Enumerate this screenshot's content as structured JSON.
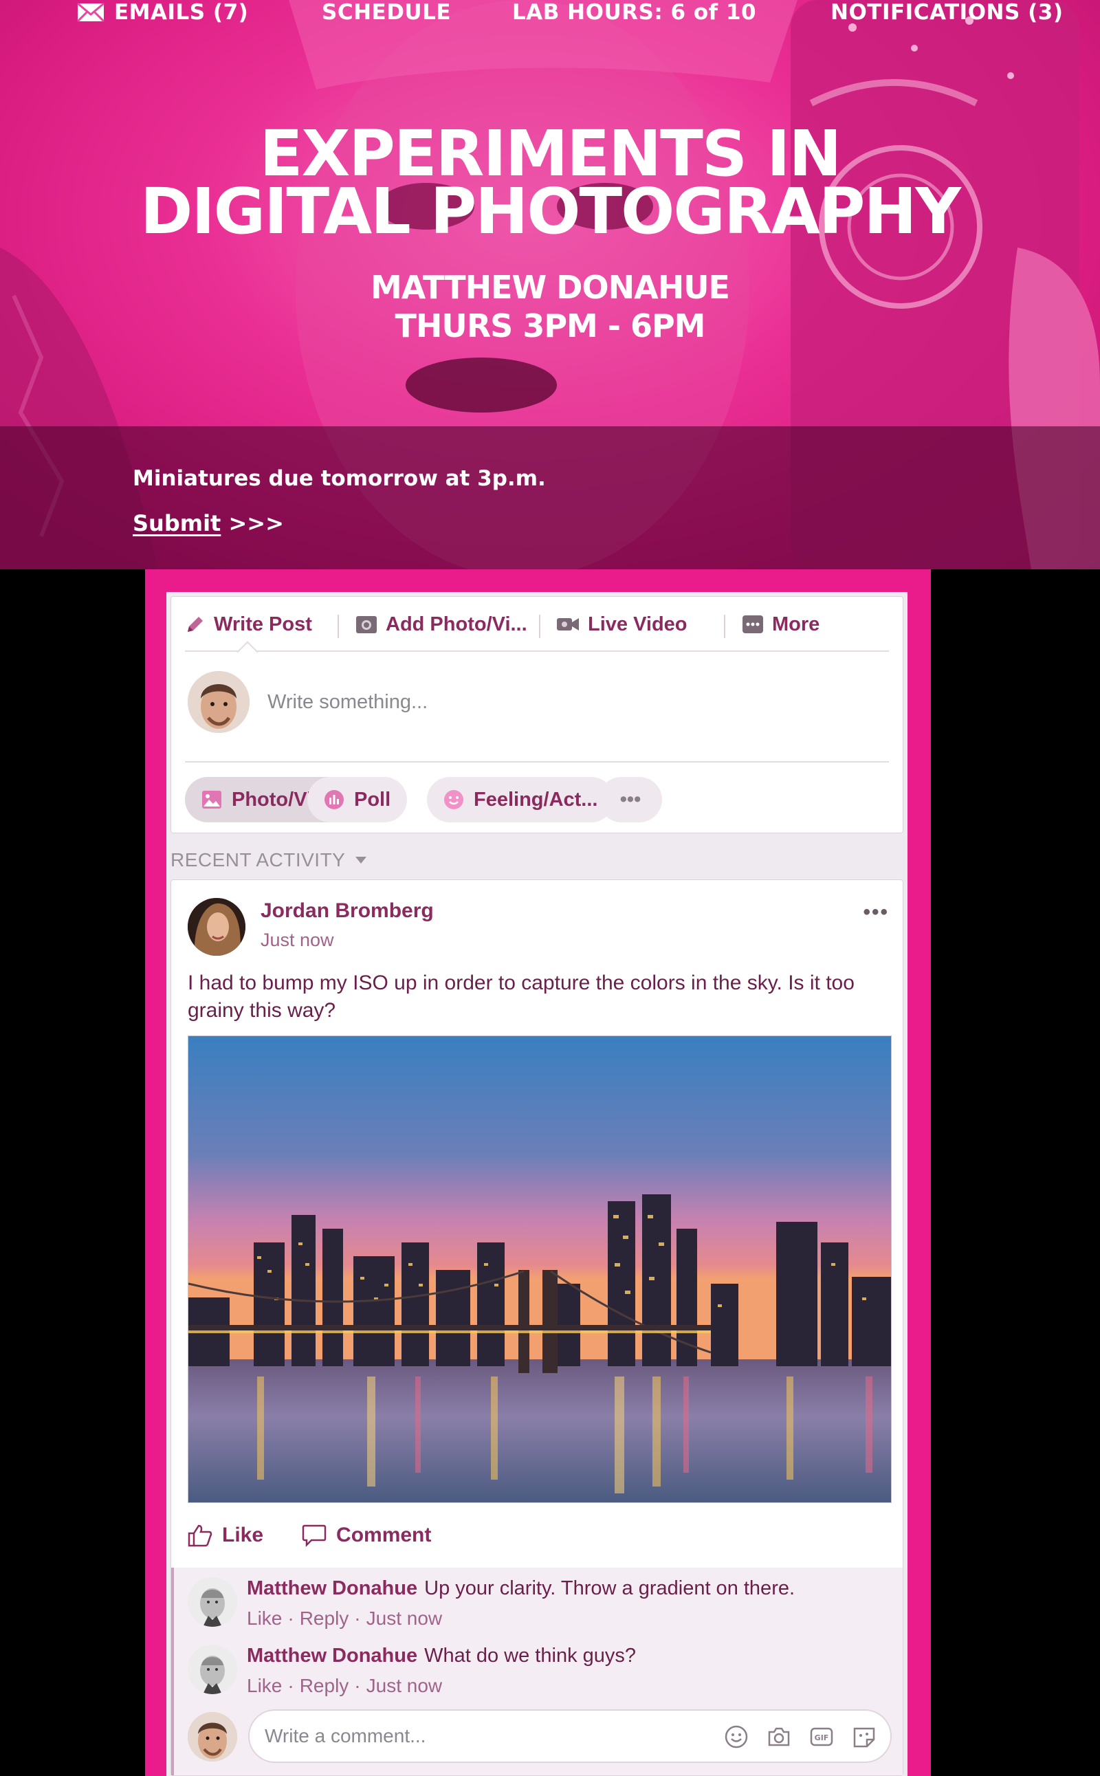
{
  "nav": {
    "emails": "EMAILS (7)",
    "schedule": "SCHEDULE",
    "lab_hours": "LAB HOURS: 6 of 10",
    "notifications": "NOTIFICATIONS (3)"
  },
  "hero": {
    "title_line1": "EXPERIMENTS IN",
    "title_line2": "DIGITAL PHOTOGRAPHY",
    "instructor": "MATTHEW DONAHUE",
    "time": "THURS 3PM - 6PM",
    "accent_color": "#ea1b8a"
  },
  "banner": {
    "message": "Miniatures due tomorrow at 3p.m.",
    "submit_label": "Submit",
    "submit_arrows": ">>>"
  },
  "composer": {
    "tabs": [
      "Write Post",
      "Add Photo/Vi...",
      "Live Video",
      "More"
    ],
    "placeholder": "Write something...",
    "pills": [
      "Photo/Video",
      "Poll",
      "Feeling/Act...",
      "•••"
    ]
  },
  "feed": {
    "section_label": "RECENT ACTIVITY"
  },
  "post": {
    "author": "Jordan Bromberg",
    "time": "Just now",
    "more": "•••",
    "text": "I had to bump my ISO up in order to capture the colors in the sky. Is it too grainy this way?",
    "like_label": "Like",
    "comment_label": "Comment"
  },
  "comments": [
    {
      "author": "Matthew Donahue",
      "text": "Up your clarity. Throw a gradient on there.",
      "like": "Like",
      "reply": "Reply",
      "time": "Just now"
    },
    {
      "author": "Matthew Donahue",
      "text": "What do we think guys?",
      "like": "Like",
      "reply": "Reply",
      "time": "Just now"
    }
  ],
  "write_comment": {
    "placeholder": "Write a comment...",
    "icons": [
      "emoji-icon",
      "camera-icon",
      "gif-icon",
      "sticker-icon"
    ]
  }
}
